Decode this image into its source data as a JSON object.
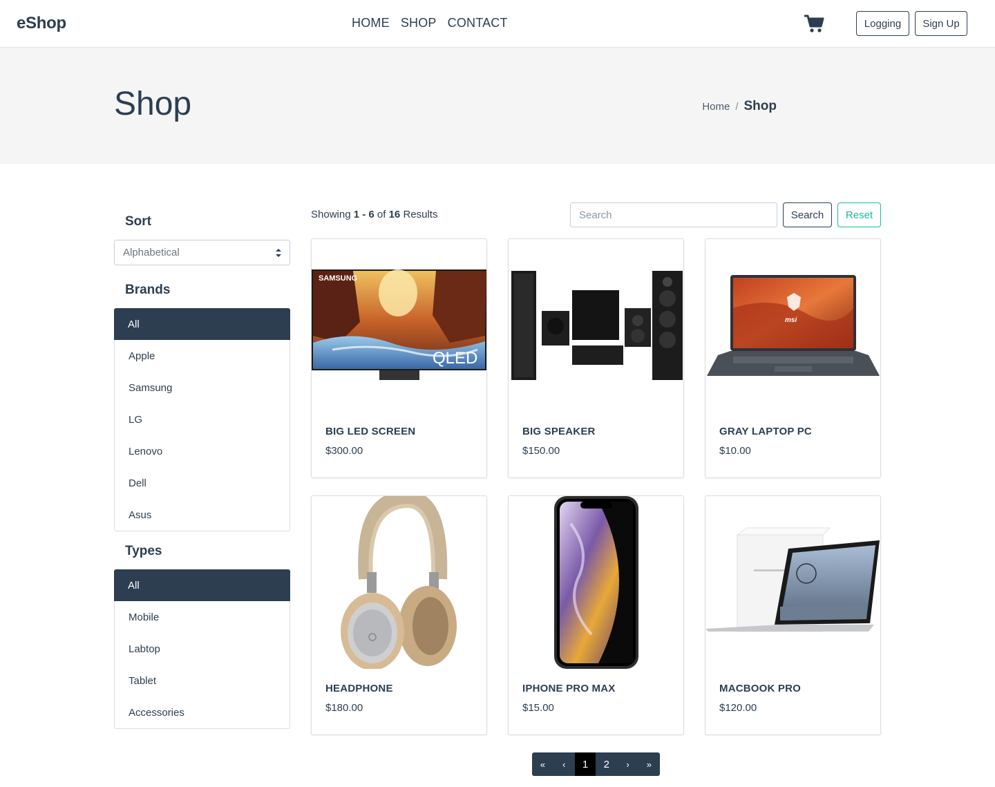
{
  "navbar": {
    "brand": "eShop",
    "links": [
      "HOME",
      "SHOP",
      "CONTACT"
    ],
    "login_label": "Logging",
    "signup_label": "Sign Up"
  },
  "header": {
    "title": "Shop",
    "breadcrumb_home": "Home",
    "breadcrumb_sep": "/",
    "breadcrumb_current": "Shop"
  },
  "sidebar": {
    "sort_heading": "Sort",
    "sort_value": "Alphabetical",
    "brands_heading": "Brands",
    "brands": [
      "All",
      "Apple",
      "Samsung",
      "LG",
      "Lenovo",
      "Dell",
      "Asus"
    ],
    "types_heading": "Types",
    "types": [
      "All",
      "Mobile",
      "Labtop",
      "Tablet",
      "Accessories"
    ]
  },
  "results": {
    "prefix": "Showing ",
    "range": "1 - 6",
    "middle": " of ",
    "total": "16",
    "suffix": " Results"
  },
  "search": {
    "placeholder": "Search",
    "search_label": "Search",
    "reset_label": "Reset"
  },
  "products": [
    {
      "name": "BIG LED SCREEN",
      "price": "$300.00",
      "image": "qled-tv"
    },
    {
      "name": "BIG SPEAKER",
      "price": "$150.00",
      "image": "speaker-set"
    },
    {
      "name": "GRAY LAPTOP PC",
      "price": "$10.00",
      "image": "msi-laptop"
    },
    {
      "name": "HEADPHONE",
      "price": "$180.00",
      "image": "headphone"
    },
    {
      "name": "IPHONE PRO MAX",
      "price": "$15.00",
      "image": "iphone"
    },
    {
      "name": "MACBOOK PRO",
      "price": "$120.00",
      "image": "macbook"
    }
  ],
  "image_text": {
    "tv_logo": "SAMSUNG",
    "tv_badge": "QLED",
    "laptop_logo": "msi"
  },
  "pagination": {
    "first": "«",
    "prev": "‹",
    "pages": [
      "1",
      "2"
    ],
    "current": "1",
    "next": "›",
    "last": "»"
  },
  "colors": {
    "primary": "#2c3e50",
    "accent": "#18bc9c",
    "header_bg": "#f5f5f5"
  },
  "icons": {
    "cart": "shopping-cart-icon",
    "select": "select-arrows-icon"
  }
}
